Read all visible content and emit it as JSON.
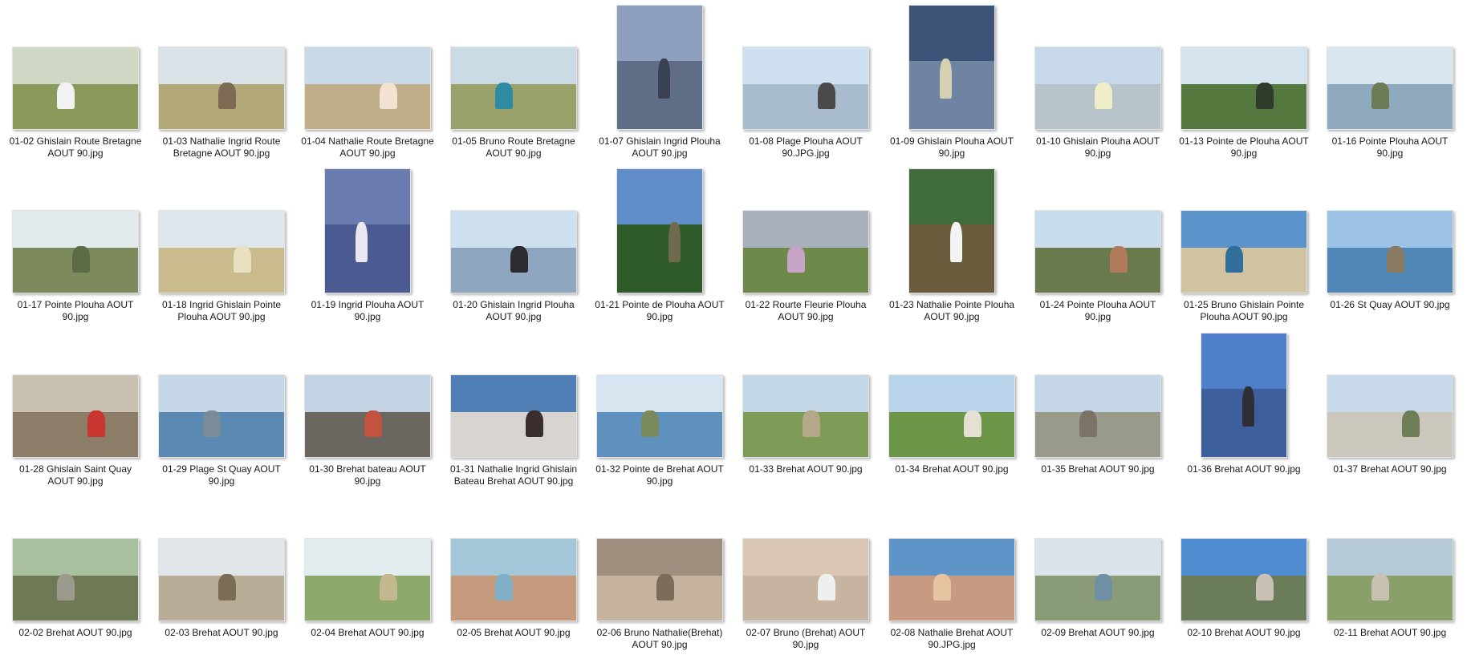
{
  "files": [
    {
      "name": "01-02 Ghislain Route Bretagne AOUT 90.jpg",
      "orient": "l",
      "sky": "#cfd8c4",
      "ground": "#8a9a5a",
      "fig": "#f2f2f2"
    },
    {
      "name": "01-03 Nathalie Ingrid Route Bretagne AOUT 90.jpg",
      "orient": "l",
      "sky": "#d9e2e6",
      "ground": "#b3a877",
      "fig": "#7d6a52"
    },
    {
      "name": "01-04 Nathalie Route Bretagne AOUT 90.jpg",
      "orient": "l",
      "sky": "#c9dae6",
      "ground": "#bfae87",
      "fig": "#f1e2d2"
    },
    {
      "name": "01-05 Bruno Route Bretagne AOUT 90.jpg",
      "orient": "l",
      "sky": "#cbdbe6",
      "ground": "#9aa16b",
      "fig": "#2f8aa3"
    },
    {
      "name": "01-07 Ghislain Ingrid Plouha AOUT 90.jpg",
      "orient": "p",
      "sky": "#8ea0be",
      "ground": "#5f6e86",
      "fig": "#394152"
    },
    {
      "name": "01-08 Plage Plouha AOUT 90.JPG.jpg",
      "orient": "l",
      "sky": "#cfe0f0",
      "ground": "#a9bccd",
      "fig": "#4a4a4a"
    },
    {
      "name": "01-09 Ghislain Plouha AOUT 90.jpg",
      "orient": "p",
      "sky": "#3c5477",
      "ground": "#6f84a2",
      "fig": "#d4d0b0"
    },
    {
      "name": "01-10 Ghislain Plouha AOUT 90.jpg",
      "orient": "l",
      "sky": "#c7d8ea",
      "ground": "#b7c3c9",
      "fig": "#f0eec8"
    },
    {
      "name": "01-13 Pointe de Plouha AOUT 90.jpg",
      "orient": "l",
      "sky": "#d5e3ee",
      "ground": "#55783f",
      "fig": "#2e3b2a"
    },
    {
      "name": "01-16 Pointe Plouha AOUT 90.jpg",
      "orient": "l",
      "sky": "#d9e6ef",
      "ground": "#8fa9be",
      "fig": "#6c7a55"
    },
    {
      "name": "01-17 Pointe Plouha AOUT 90.jpg",
      "orient": "l",
      "sky": "#e2eaee",
      "ground": "#7d8a5c",
      "fig": "#5c6b44"
    },
    {
      "name": "01-18 Ingrid Ghislain Pointe Plouha AOUT 90.jpg",
      "orient": "l",
      "sky": "#dde7ec",
      "ground": "#c9bb8e",
      "fig": "#e9e0bf"
    },
    {
      "name": "01-19 Ingrid Plouha AOUT 90.jpg",
      "orient": "p",
      "sky": "#6a7bb0",
      "ground": "#4c5a92",
      "fig": "#e8e8ee"
    },
    {
      "name": "01-20 Ghislain Ingrid Plouha AOUT 90.jpg",
      "orient": "l",
      "sky": "#cfe0ee",
      "ground": "#8ea6bf",
      "fig": "#2c2c30"
    },
    {
      "name": "01-21 Pointe de Plouha AOUT 90.jpg",
      "orient": "p",
      "sky": "#5f8ec9",
      "ground": "#2f5a2a",
      "fig": "#6f6a4e"
    },
    {
      "name": "01-22 Rourte Fleurie Plouha AOUT 90.jpg",
      "orient": "l",
      "sky": "#a9b2bc",
      "ground": "#6d8a4c",
      "fig": "#c7a3c8"
    },
    {
      "name": "01-23 Nathalie Pointe Plouha AOUT 90.jpg",
      "orient": "p",
      "sky": "#3f6c3a",
      "ground": "#6b5b3d",
      "fig": "#f3f3f3"
    },
    {
      "name": "01-24 Pointe Plouha AOUT 90.jpg",
      "orient": "l",
      "sky": "#c9dcec",
      "ground": "#6a7a4c",
      "fig": "#b07b5a"
    },
    {
      "name": "01-25 Bruno Ghislain Pointe Plouha AOUT 90.jpg",
      "orient": "l",
      "sky": "#5b94cb",
      "ground": "#cfc3a2",
      "fig": "#2f6f9a"
    },
    {
      "name": "01-26 St Quay AOUT 90.jpg",
      "orient": "l",
      "sky": "#9cc3e6",
      "ground": "#4f86b5",
      "fig": "#8a7a62"
    },
    {
      "name": "01-28 Ghislain Saint Quay AOUT 90.jpg",
      "orient": "l",
      "sky": "#c9c1b2",
      "ground": "#8c7d68",
      "fig": "#c9362f"
    },
    {
      "name": "01-29 Plage St Quay AOUT 90.jpg",
      "orient": "l",
      "sky": "#c6d7e8",
      "ground": "#5c89b2",
      "fig": "#7a8b9a"
    },
    {
      "name": "01-30 Brehat bateau AOUT 90.jpg",
      "orient": "l",
      "sky": "#c3d3e4",
      "ground": "#6c6660",
      "fig": "#c2543f"
    },
    {
      "name": "01-31 Nathalie Ingrid Ghislain Bateau Brehat AOUT 90.jpg",
      "orient": "l",
      "sky": "#4f7fb5",
      "ground": "#d8d4d0",
      "fig": "#3a2f2c"
    },
    {
      "name": "01-32 Pointe de Brehat AOUT 90.jpg",
      "orient": "l",
      "sky": "#d7e5f1",
      "ground": "#5e91be",
      "fig": "#7a8a5a"
    },
    {
      "name": "01-33 Brehat AOUT 90.jpg",
      "orient": "l",
      "sky": "#c4d8e8",
      "ground": "#7e9c57",
      "fig": "#b4a888"
    },
    {
      "name": "01-34 Brehat AOUT 90.jpg",
      "orient": "l",
      "sky": "#b9d4ea",
      "ground": "#6c9548",
      "fig": "#e4e0d4"
    },
    {
      "name": "01-35 Brehat AOUT 90.jpg",
      "orient": "l",
      "sky": "#c5d6e6",
      "ground": "#9a9a8a",
      "fig": "#7b7466"
    },
    {
      "name": "01-36 Brehat AOUT 90.jpg",
      "orient": "p",
      "sky": "#4f7fcb",
      "ground": "#3d5f9c",
      "fig": "#2e2e34"
    },
    {
      "name": "01-37 Brehat AOUT 90.jpg",
      "orient": "l",
      "sky": "#c7d9ea",
      "ground": "#cbc7bd",
      "fig": "#6e7f58"
    },
    {
      "name": "02-02 Brehat AOUT 90.jpg",
      "orient": "l",
      "sky": "#a8c0a0",
      "ground": "#6d7a55",
      "fig": "#9c9a8c"
    },
    {
      "name": "02-03 Brehat AOUT 90.jpg",
      "orient": "l",
      "sky": "#e1e6ea",
      "ground": "#b9ad98",
      "fig": "#7b6c55"
    },
    {
      "name": "02-04 Brehat AOUT 90.jpg",
      "orient": "l",
      "sky": "#e3ecef",
      "ground": "#8ca86a",
      "fig": "#c2b78e"
    },
    {
      "name": "02-05 Brehat AOUT 90.jpg",
      "orient": "l",
      "sky": "#a3c7d8",
      "ground": "#c59a7c",
      "fig": "#7fb0c7"
    },
    {
      "name": "02-06 Bruno Nathalie(Brehat) AOUT 90.jpg",
      "orient": "l",
      "sky": "#9e8e7e",
      "ground": "#c5b39d",
      "fig": "#7c6a5a"
    },
    {
      "name": "02-07 Bruno (Brehat) AOUT 90.jpg",
      "orient": "l",
      "sky": "#d9c7b3",
      "ground": "#c6b3a0",
      "fig": "#eef0ee"
    },
    {
      "name": "02-08 Nathalie Brehat AOUT 90.JPG.jpg",
      "orient": "l",
      "sky": "#5f94c8",
      "ground": "#c69b82",
      "fig": "#e6c3a1"
    },
    {
      "name": "02-09 Brehat AOUT 90.jpg",
      "orient": "l",
      "sky": "#d9e3e8",
      "ground": "#8a9b77",
      "fig": "#6f8fa3"
    },
    {
      "name": "02-10 Brehat AOUT 90.jpg",
      "orient": "l",
      "sky": "#4f8cd0",
      "ground": "#6a7c5a",
      "fig": "#c9c2b4"
    },
    {
      "name": "02-11 Brehat AOUT 90.jpg",
      "orient": "l",
      "sky": "#b6c9d6",
      "ground": "#8aa06a",
      "fig": "#c8c0b0"
    }
  ]
}
